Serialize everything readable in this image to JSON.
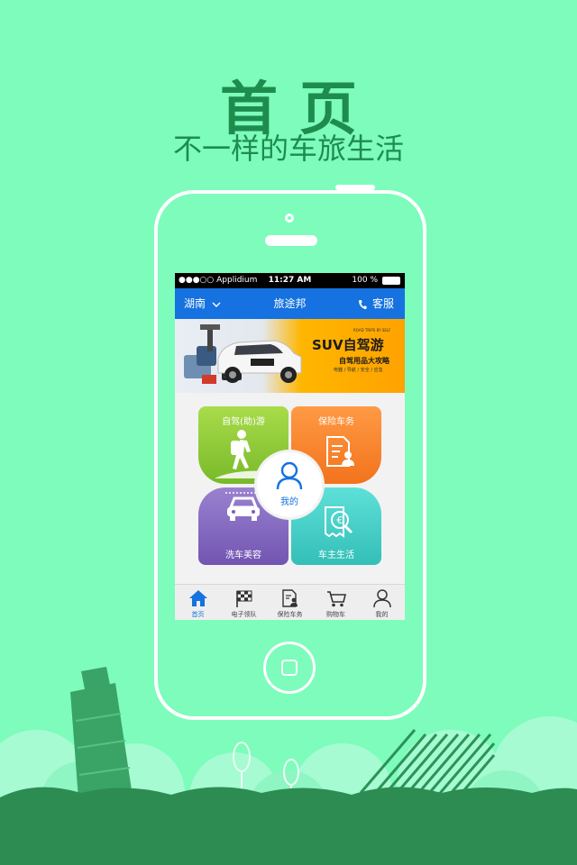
{
  "headline": {
    "title": "首页",
    "subtitle": "不一样的车旅生活"
  },
  "status_bar": {
    "carrier": "●●●○○ Applidium",
    "time": "11:27 AM",
    "battery": "100 %"
  },
  "nav_bar": {
    "location": "湖南",
    "title": "旅途邦",
    "service": "客服"
  },
  "banner": {
    "tagline": "ROAD TRIPS BY SELF",
    "headline": "SUV自驾游",
    "subheadline": "自驾用品大攻略",
    "tags": "电器 / 导航 / 安全 / 应急",
    "slide_count": 5,
    "active_slide": 1
  },
  "tiles": [
    {
      "label": "自驾(助)游",
      "icon": "hiker-icon",
      "color": "#8fcb38"
    },
    {
      "label": "保险车务",
      "icon": "document-person-icon",
      "color": "#f7842f"
    },
    {
      "label": "洗车美容",
      "icon": "car-icon",
      "color": "#8369c0"
    },
    {
      "label": "车主生活",
      "icon": "euro-receipt-icon",
      "color": "#45d0c9"
    }
  ],
  "center_button": {
    "label": "我的",
    "icon": "user-icon"
  },
  "tab_bar": {
    "items": [
      {
        "label": "首页",
        "icon": "home-icon",
        "active": true
      },
      {
        "label": "电子领队",
        "icon": "checkered-flag-icon",
        "active": false
      },
      {
        "label": "保险车务",
        "icon": "document-person-icon",
        "active": false
      },
      {
        "label": "购物车",
        "icon": "shopping-cart-icon",
        "active": false
      },
      {
        "label": "我的",
        "icon": "user-icon",
        "active": false
      }
    ]
  },
  "colors": {
    "background": "#7dfcbc",
    "headline": "#1e8c4c",
    "accent": "#1572e0",
    "ground": "#2d8c52"
  }
}
